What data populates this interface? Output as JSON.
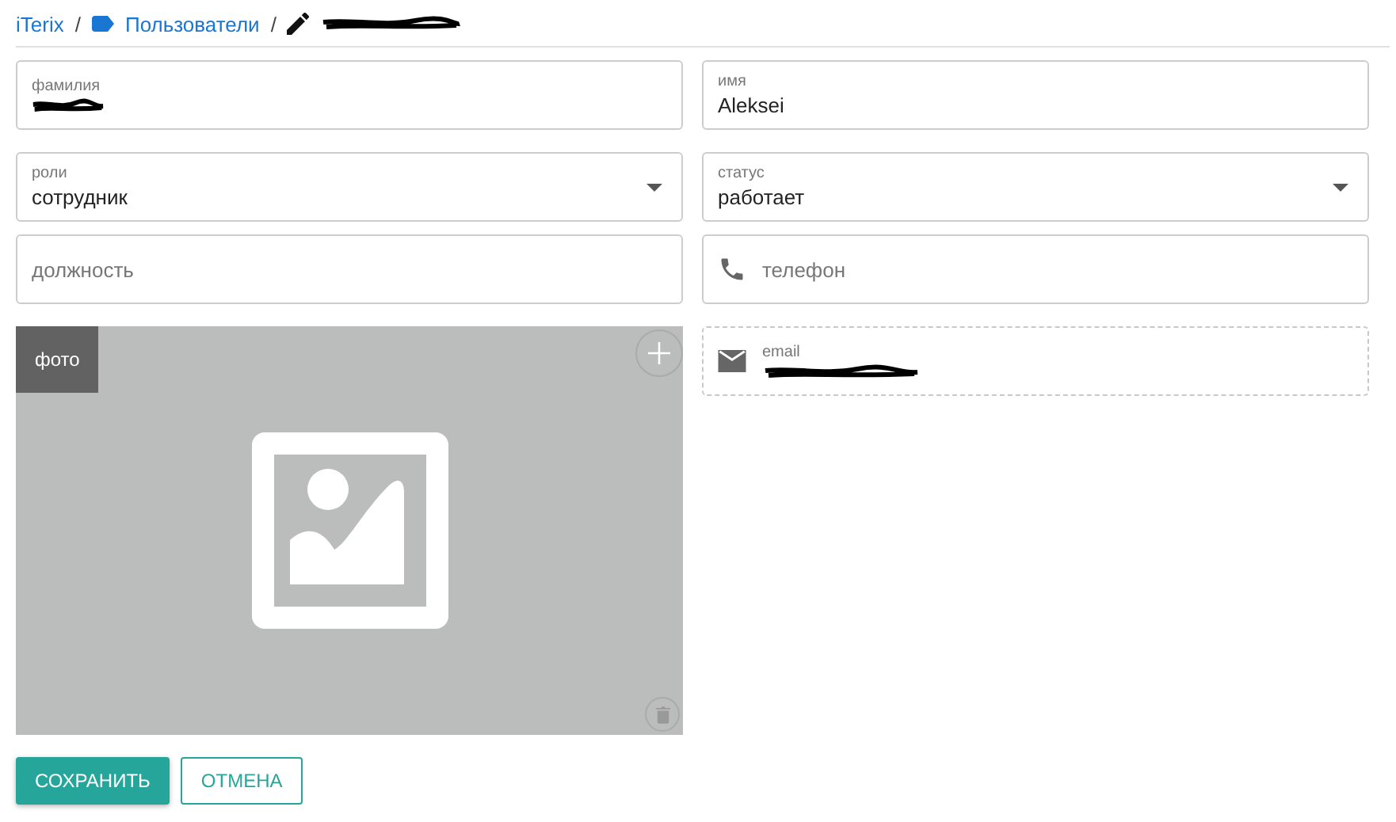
{
  "breadcrumb": {
    "separator": "/",
    "items": [
      {
        "kind": "link",
        "text": "iTerix"
      },
      {
        "kind": "tag-link",
        "text": "Пользователи"
      },
      {
        "kind": "edit",
        "redacted": true
      }
    ]
  },
  "fields": [
    {
      "kind": "text",
      "label": "фамилия",
      "redacted": true
    },
    {
      "kind": "text",
      "label": "имя",
      "value": "Aleksei"
    },
    {
      "kind": "select",
      "label": "роли",
      "value": "сотрудник"
    },
    {
      "kind": "select",
      "label": "статус",
      "value": "работает"
    },
    {
      "kind": "text",
      "placeholder": "должность"
    },
    {
      "kind": "phone",
      "placeholder": "телефон"
    },
    {
      "kind": "photo",
      "label": "фото"
    },
    {
      "kind": "email",
      "label": "email",
      "redacted": true,
      "readonly": true
    }
  ],
  "buttons": [
    {
      "kind": "primary",
      "label": "СОХРАНИТЬ"
    },
    {
      "kind": "outline",
      "label": "ОТМЕНА"
    }
  ]
}
